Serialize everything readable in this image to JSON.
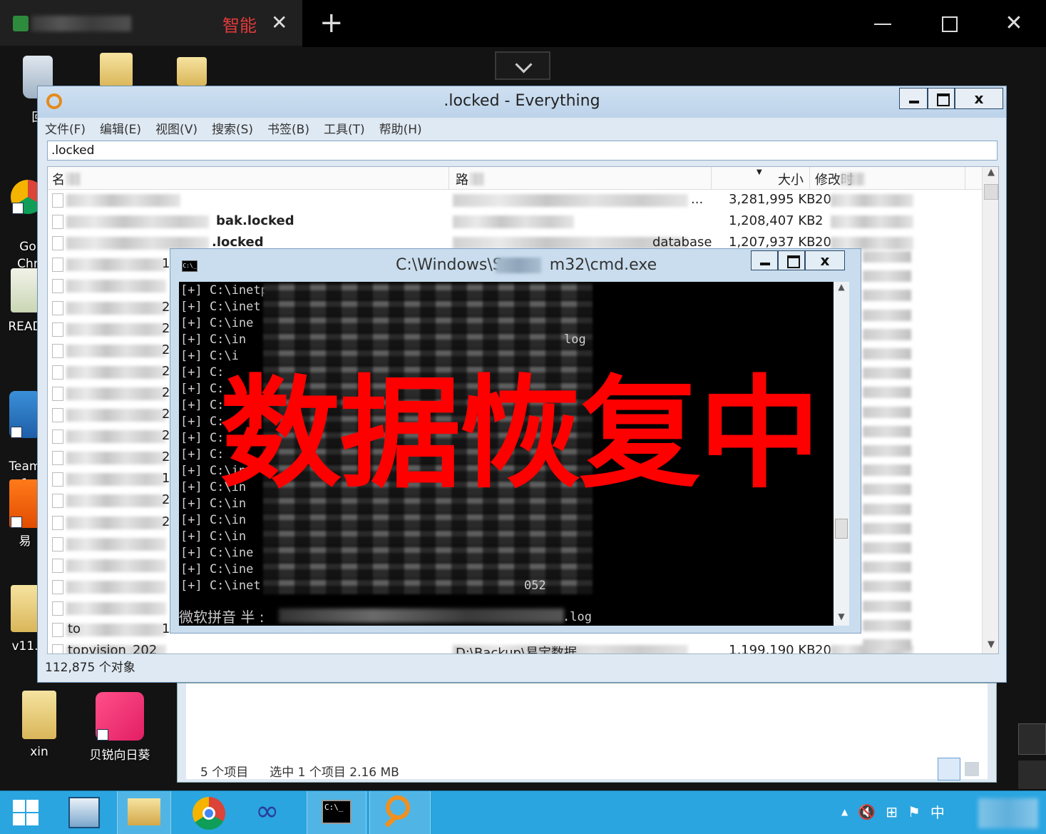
{
  "remote_session": {
    "tab_label": "智能",
    "tab_close": "✕",
    "add_tab": "+",
    "close": "✕"
  },
  "desktop": {
    "icons": [
      {
        "label": "回",
        "icon": "recycle-bin-icon"
      },
      {
        "label": "Go\nChr",
        "icon": "chrome-shortcut-icon"
      },
      {
        "label": "READ",
        "icon": "document-icon"
      },
      {
        "label": "Team\n1",
        "icon": "teamviewer-shortcut-icon"
      },
      {
        "label": "易",
        "icon": "app-shortcut-icon"
      },
      {
        "label": "v11.",
        "icon": "folder-icon"
      },
      {
        "label": "xin",
        "icon": "folder-icon"
      },
      {
        "label": "贝锐向日葵",
        "icon": "sunflower-shortcut-icon"
      }
    ]
  },
  "everything": {
    "title": ".locked  - Everything",
    "menu": [
      "文件(F)",
      "编辑(E)",
      "视图(V)",
      "搜索(S)",
      "书签(B)",
      "工具(T)",
      "帮助(H)"
    ],
    "search_value": ".locked",
    "columns": {
      "name": "名",
      "path": "路",
      "size": "大小",
      "modified": "修改时"
    },
    "rows": [
      {
        "name": "",
        "path": "...",
        "size": "3,281,995 KB",
        "modified": "20"
      },
      {
        "name": "bak.locked",
        "path": "",
        "size": "1,208,407 KB",
        "modified": "2"
      },
      {
        "name": ".locked",
        "path": "database",
        "size": "1,207,937 KB",
        "modified": "20"
      },
      {
        "name": "topvision_202",
        "path": "D:\\Backup\\易宝数据",
        "size": "1,199,190 KB",
        "modified": "20"
      }
    ],
    "partial_name_digits": [
      "12",
      "",
      "2",
      "2",
      "2",
      "2",
      "2",
      "2",
      "2",
      "2",
      "1",
      "2",
      "2",
      "",
      "",
      "",
      "",
      "12"
    ],
    "status": "112,875 个对象",
    "row12_prefix": "to"
  },
  "cmd": {
    "title": "C:\\Windows\\S",
    "title_tail": "m32\\cmd.exe",
    "icon_text": "C:\\_",
    "lines": [
      "[+] C:\\inetp",
      "[+] C:\\inet",
      "[+] C:\\ine",
      "[+] C:\\in",
      "[+] C:\\i",
      "[+] C:",
      "[+] C:",
      "[+] C:",
      "[+] C:",
      "[+] C:",
      "[+] C:",
      "[+] C:\\in",
      "[+] C:\\in",
      "[+] C:\\in",
      "[+] C:\\in",
      "[+] C:\\in",
      "[+] C:\\ine",
      "[+] C:\\ine",
      "[+] C:\\inet"
    ],
    "line_tails": {
      "3": "log",
      "18": "052"
    },
    "ime": "微软拼音 半 :",
    "ime_tail": ".log"
  },
  "overlay_text": "数据恢复中",
  "explorer": {
    "item_count": "5 个项目",
    "selected": "选中 1 个项目  2.16 MB"
  },
  "taskbar": {
    "items": [
      "start-icon",
      "server-manager-icon",
      "file-explorer-icon",
      "chrome-icon",
      "infinity-icon",
      "cmd-icon",
      "everything-icon"
    ],
    "ime": "中"
  },
  "colors": {
    "overlay": "#ff0000",
    "taskbar": "#2aa5e0",
    "tab_label": "#e23a3a"
  }
}
